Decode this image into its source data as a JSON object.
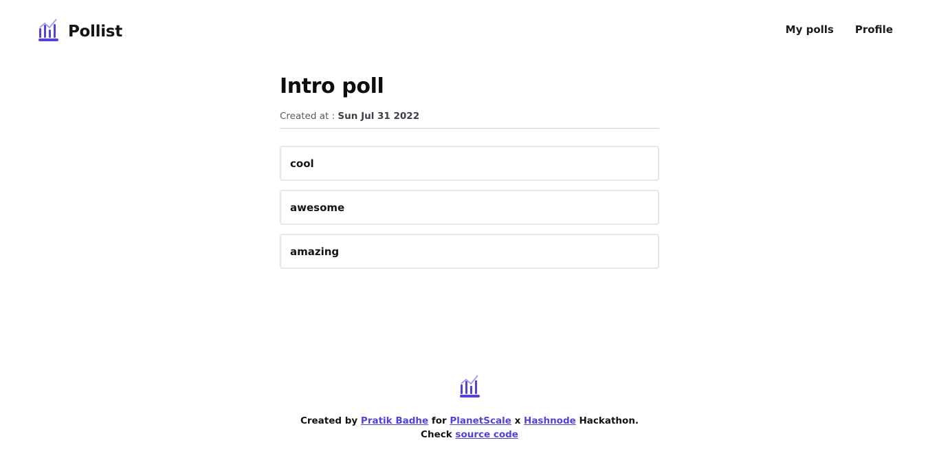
{
  "header": {
    "brand_name": "Pollist",
    "nav": [
      {
        "label": "My polls"
      },
      {
        "label": "Profile"
      }
    ]
  },
  "poll": {
    "title": "Intro poll",
    "created_label": "Created at :",
    "created_date": "Sun Jul 31 2022",
    "options": [
      {
        "label": "cool"
      },
      {
        "label": "awesome"
      },
      {
        "label": "amazing"
      }
    ]
  },
  "footer": {
    "line1": {
      "prefix": "Created by",
      "author_link": "Pratik Badhe",
      "for_text": "for",
      "link_planetscale": "PlanetScale",
      "x_text": "x",
      "link_hashnode": "Hashnode",
      "suffix": "Hackathon."
    },
    "line2": {
      "prefix": "Check",
      "source_link": "source code"
    }
  },
  "colors": {
    "accent": "#5143d9",
    "accent_light": "#a59cf0",
    "border": "#e7e7ea"
  },
  "icons": {
    "logo": "bar-chart-icon"
  }
}
